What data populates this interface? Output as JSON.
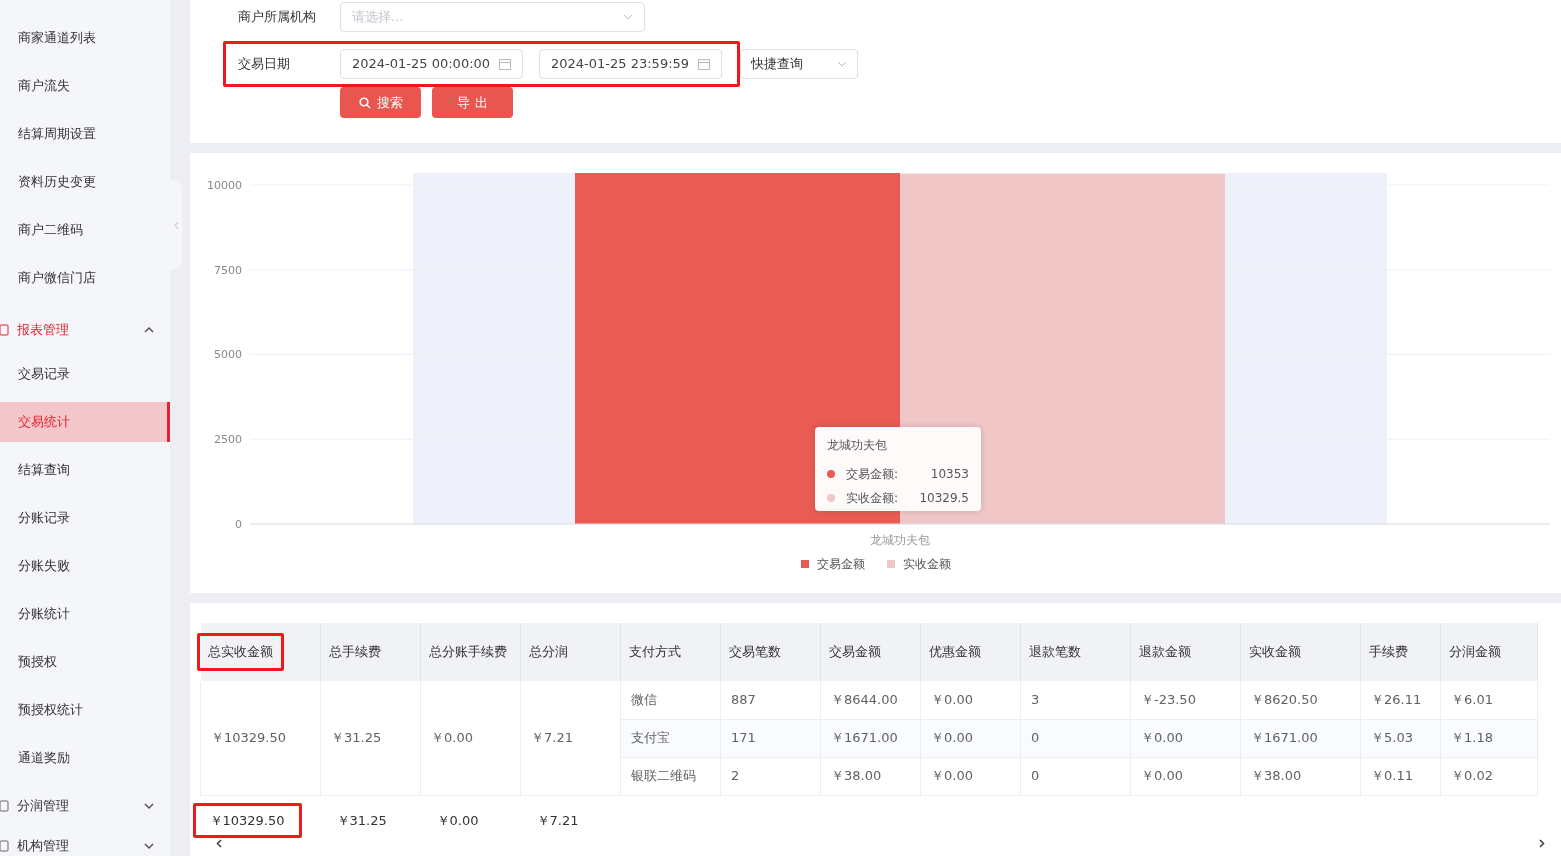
{
  "sidebar": {
    "items": [
      {
        "label": "商家通道列表",
        "kind": "item",
        "selected": false
      },
      {
        "label": "商户流失",
        "kind": "item",
        "selected": false
      },
      {
        "label": "结算周期设置",
        "kind": "item",
        "selected": false
      },
      {
        "label": "资料历史变更",
        "kind": "item",
        "selected": false
      },
      {
        "label": "商户二维码",
        "kind": "item",
        "selected": false
      },
      {
        "label": "商户微信门店",
        "kind": "item",
        "selected": false
      },
      {
        "label": "报表管理",
        "kind": "group",
        "expanded": true,
        "children": [
          {
            "label": "交易记录",
            "selected": false
          },
          {
            "label": "交易统计",
            "selected": true
          },
          {
            "label": "结算查询",
            "selected": false
          },
          {
            "label": "分账记录",
            "selected": false
          },
          {
            "label": "分账失败",
            "selected": false
          },
          {
            "label": "分账统计",
            "selected": false
          },
          {
            "label": "预授权",
            "selected": false
          },
          {
            "label": "预授权统计",
            "selected": false
          },
          {
            "label": "通道奖励",
            "selected": false
          }
        ]
      },
      {
        "label": "分润管理",
        "kind": "group",
        "expanded": false
      },
      {
        "label": "机构管理",
        "kind": "group",
        "expanded": false
      }
    ]
  },
  "filters": {
    "org": {
      "label": "商户所属机构",
      "placeholder": "请选择..."
    },
    "date": {
      "label": "交易日期",
      "start": "2024-01-25 00:00:00",
      "end": "2024-01-25 23:59:59",
      "quick": "快捷查询"
    },
    "buttons": [
      {
        "label": "搜索",
        "kind": "search"
      },
      {
        "label": "导 出",
        "kind": "plain"
      }
    ]
  },
  "chart": {
    "chart_data": {
      "type": "bar",
      "categories": [
        "龙城功夫包"
      ],
      "series": [
        {
          "name": "交易金额",
          "color": "#e95b53",
          "values": [
            10353
          ]
        },
        {
          "name": "实收金额",
          "color": "#f0c6c7",
          "values": [
            10329.5
          ]
        }
      ],
      "ylim": [
        0,
        10353
      ],
      "yticks": [
        0,
        2500,
        5000,
        7500,
        10000
      ],
      "grid": true,
      "legend": true
    },
    "tooltip": {
      "title": "龙城功夫包",
      "rows": [
        {
          "label": "交易金额:",
          "value": "10353",
          "color": "#e95b53"
        },
        {
          "label": "实收金额:",
          "value": "10329.5",
          "color": "#f0c6c7"
        }
      ]
    }
  },
  "table": {
    "columns": [
      "总实收金额",
      "总手续费",
      "总分账手续费",
      "总分润",
      "支付方式",
      "交易笔数",
      "交易金额",
      "优惠金额",
      "退款笔数",
      "退款金额",
      "实收金额",
      "手续费",
      "分润金额"
    ],
    "rows": [
      [
        {
          "text": "￥10329.50",
          "rowspan": 3
        },
        {
          "text": "￥31.25",
          "rowspan": 3
        },
        {
          "text": "￥0.00",
          "rowspan": 3
        },
        {
          "text": "￥7.21",
          "rowspan": 3
        },
        "微信",
        "887",
        "￥8644.00",
        "￥0.00",
        "3",
        "￥-23.50",
        "￥8620.50",
        "￥26.11",
        "￥6.01"
      ],
      [
        "支付宝",
        "171",
        "￥1671.00",
        "￥0.00",
        "0",
        "￥0.00",
        "￥1671.00",
        "￥5.03",
        "￥1.18"
      ],
      [
        "银联二维码",
        "2",
        "￥38.00",
        "￥0.00",
        "0",
        "￥0.00",
        "￥38.00",
        "￥0.11",
        "￥0.02"
      ]
    ],
    "summary": [
      "￥10329.50",
      "￥31.25",
      "￥0.00",
      "￥7.21"
    ]
  }
}
